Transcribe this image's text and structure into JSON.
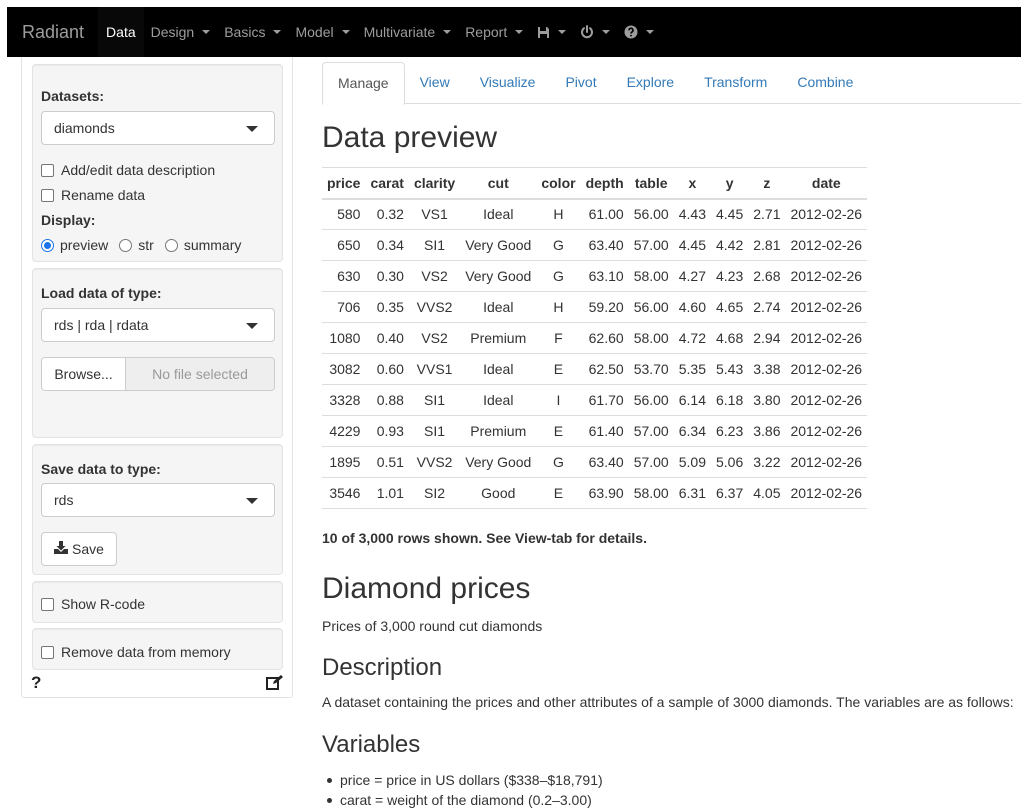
{
  "navbar": {
    "brand": "Radiant",
    "items": [
      {
        "label": "Data",
        "active": true
      },
      {
        "label": "Design",
        "caret": true
      },
      {
        "label": "Basics",
        "caret": true
      },
      {
        "label": "Model",
        "caret": true
      },
      {
        "label": "Multivariate",
        "caret": true
      },
      {
        "label": "Report",
        "caret": true
      }
    ],
    "icons": [
      "save-icon",
      "power-icon",
      "help-circle-icon"
    ]
  },
  "sidebar": {
    "datasets_label": "Datasets:",
    "dataset_selected": "diamonds",
    "add_edit_description": "Add/edit data description",
    "rename_data": "Rename data",
    "display_label": "Display:",
    "display_options": [
      "preview",
      "str",
      "summary"
    ],
    "display_selected": "preview",
    "load_label": "Load data of type:",
    "load_type_selected": "rds | rda | rdata",
    "browse_label": "Browse...",
    "file_placeholder": "No file selected",
    "save_label": "Save data to type:",
    "save_type_selected": "rds",
    "save_button": "Save",
    "show_rcode": "Show R-code",
    "remove_data": "Remove data from memory",
    "help_glyph": "?"
  },
  "tabs": [
    "Manage",
    "View",
    "Visualize",
    "Pivot",
    "Explore",
    "Transform",
    "Combine"
  ],
  "active_tab": "Manage",
  "preview": {
    "title": "Data preview",
    "columns": [
      "price",
      "carat",
      "clarity",
      "cut",
      "color",
      "depth",
      "table",
      "x",
      "y",
      "z",
      "date"
    ],
    "rows": [
      [
        "580",
        "0.32",
        "VS1",
        "Ideal",
        "H",
        "61.00",
        "56.00",
        "4.43",
        "4.45",
        "2.71",
        "2012-02-26"
      ],
      [
        "650",
        "0.34",
        "SI1",
        "Very Good",
        "G",
        "63.40",
        "57.00",
        "4.45",
        "4.42",
        "2.81",
        "2012-02-26"
      ],
      [
        "630",
        "0.30",
        "VS2",
        "Very Good",
        "G",
        "63.10",
        "58.00",
        "4.27",
        "4.23",
        "2.68",
        "2012-02-26"
      ],
      [
        "706",
        "0.35",
        "VVS2",
        "Ideal",
        "H",
        "59.20",
        "56.00",
        "4.60",
        "4.65",
        "2.74",
        "2012-02-26"
      ],
      [
        "1080",
        "0.40",
        "VS2",
        "Premium",
        "F",
        "62.60",
        "58.00",
        "4.72",
        "4.68",
        "2.94",
        "2012-02-26"
      ],
      [
        "3082",
        "0.60",
        "VVS1",
        "Ideal",
        "E",
        "62.50",
        "53.70",
        "5.35",
        "5.43",
        "3.38",
        "2012-02-26"
      ],
      [
        "3328",
        "0.88",
        "SI1",
        "Ideal",
        "I",
        "61.70",
        "56.00",
        "6.14",
        "6.18",
        "3.80",
        "2012-02-26"
      ],
      [
        "4229",
        "0.93",
        "SI1",
        "Premium",
        "E",
        "61.40",
        "57.00",
        "6.34",
        "6.23",
        "3.86",
        "2012-02-26"
      ],
      [
        "1895",
        "0.51",
        "VVS2",
        "Very Good",
        "G",
        "63.40",
        "57.00",
        "5.09",
        "5.06",
        "3.22",
        "2012-02-26"
      ],
      [
        "3546",
        "1.01",
        "SI2",
        "Good",
        "E",
        "63.90",
        "58.00",
        "6.31",
        "6.37",
        "4.05",
        "2012-02-26"
      ]
    ],
    "rows_note": "10 of 3,000 rows shown. See View-tab for details."
  },
  "description": {
    "title": "Diamond prices",
    "subtitle": "Prices of 3,000 round cut diamonds",
    "desc_heading": "Description",
    "desc_text": "A dataset containing the prices and other attributes of a sample of 3000 diamonds. The variables are as follows:",
    "vars_heading": "Variables",
    "variables": [
      "price = price in US dollars ($338–$18,791)",
      "carat = weight of the diamond (0.2–3.00)"
    ]
  },
  "colors": {
    "navbar": "#000000",
    "link": "#337ab7",
    "well": "#f5f5f5",
    "radio": "#1a73e8"
  }
}
